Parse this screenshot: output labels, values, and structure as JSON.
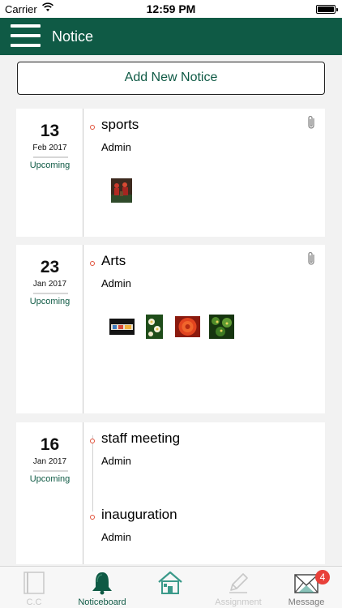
{
  "status_bar": {
    "carrier": "Carrier",
    "time": "12:59 PM"
  },
  "nav": {
    "title": "Notice"
  },
  "actions": {
    "add_notice_label": "Add New Notice"
  },
  "notices": [
    {
      "day": "13",
      "month_year": "Feb 2017",
      "status": "Upcoming",
      "items": [
        {
          "title": "sports",
          "author": "Admin"
        }
      ],
      "has_attachment": true,
      "thumbnails": [
        "sports-photo"
      ]
    },
    {
      "day": "23",
      "month_year": "Jan 2017",
      "status": "Upcoming",
      "items": [
        {
          "title": "Arts",
          "author": "Admin"
        }
      ],
      "has_attachment": true,
      "thumbnails": [
        "arts-photo-1",
        "arts-photo-2",
        "arts-photo-3",
        "arts-photo-4"
      ]
    },
    {
      "day": "16",
      "month_year": "Jan 2017",
      "status": "Upcoming",
      "items": [
        {
          "title": "staff meeting",
          "author": "Admin"
        },
        {
          "title": "inauguration",
          "author": "Admin"
        }
      ],
      "has_attachment": false,
      "thumbnails": []
    }
  ],
  "tab_bar": {
    "tabs": [
      {
        "label": "C.C",
        "icon": "book-icon",
        "state": "inactive"
      },
      {
        "label": "Noticeboard",
        "icon": "bell-icon",
        "state": "active"
      },
      {
        "label": "",
        "icon": "home-icon",
        "state": "inactive"
      },
      {
        "label": "Assignment",
        "icon": "pencil-icon",
        "state": "inactive"
      },
      {
        "label": "Message",
        "icon": "envelope-icon",
        "state": "inactive",
        "badge": "4"
      }
    ]
  },
  "colors": {
    "brand": "#0f5a45",
    "accent": "#e0523b",
    "badge": "#e8413a"
  }
}
